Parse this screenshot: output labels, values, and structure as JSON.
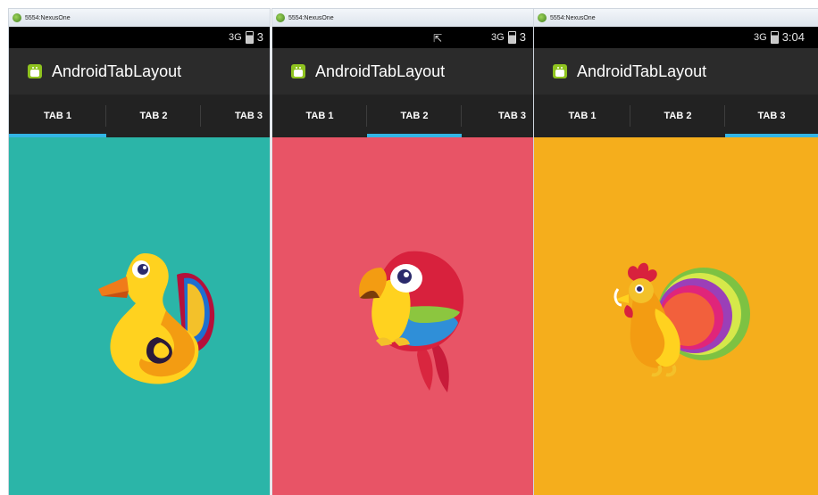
{
  "panels": [
    {
      "window_title": "5554:NexusOne",
      "status_time": "3",
      "signal": "3G",
      "app_title": "AndroidTabLayout",
      "tabs": [
        {
          "label": "TAB 1",
          "active": true
        },
        {
          "label": "TAB 2",
          "active": false
        },
        {
          "label": "TAB 3",
          "active": false
        }
      ],
      "content_color": "#2bb5a8",
      "illustration": "duck"
    },
    {
      "window_title": "5554:NexusOne",
      "status_time": "3",
      "signal": "3G",
      "app_title": "AndroidTabLayout",
      "tabs": [
        {
          "label": "TAB 1",
          "active": false
        },
        {
          "label": "TAB 2",
          "active": true
        },
        {
          "label": "TAB 3",
          "active": false
        }
      ],
      "content_color": "#e85466",
      "illustration": "parrot"
    },
    {
      "window_title": "5554:NexusOne",
      "status_time": "3:04",
      "signal": "3G",
      "app_title": "AndroidTabLayout",
      "tabs": [
        {
          "label": "TAB 1",
          "active": false
        },
        {
          "label": "TAB 2",
          "active": false
        },
        {
          "label": "TAB 3",
          "active": true
        }
      ],
      "content_color": "#f5ae1c",
      "illustration": "rooster"
    }
  ],
  "colors": {
    "tab_indicator": "#33b5e5",
    "action_bar": "#2b2b2b",
    "tab_bar": "#222222",
    "status_bar": "#000000"
  }
}
